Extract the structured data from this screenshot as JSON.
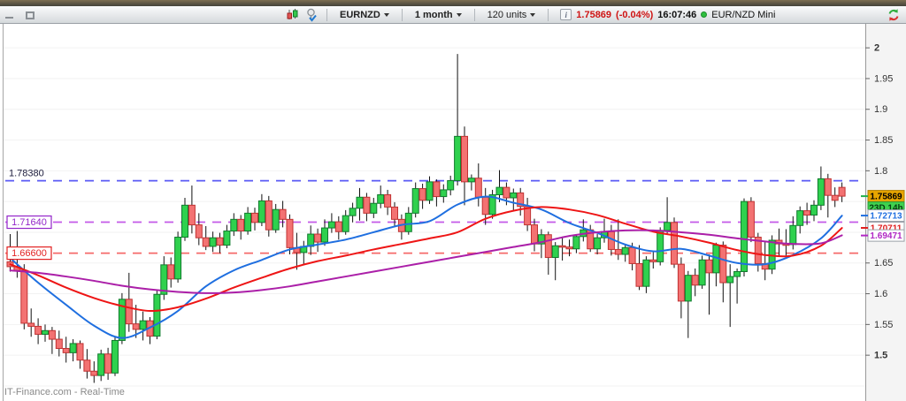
{
  "window": {
    "controls": {
      "minimize": "minimize",
      "maximize": "maximize"
    }
  },
  "toolbar": {
    "symbol_button": "EURNZD",
    "timeframe_button": "1 month",
    "units_button": "120 units",
    "info_icon": "i",
    "last_price": "1.75869",
    "change_percent": "(-0.04%)",
    "last_update_time": "16:07:46",
    "feed_name": "EUR/NZD Mini",
    "icon_names": [
      "candlestick-chart-icon",
      "screener-check-icon",
      "refresh-icon"
    ]
  },
  "footer": {
    "watermark": "IT-Finance.com - Real-Time"
  },
  "chart_data": {
    "type": "candlestick",
    "symbol": "EURNZD",
    "timeframe": "1 month",
    "visible_units": 120,
    "last_price": 1.75869,
    "change_percent": -0.04,
    "period_remaining": "23D 14h",
    "grid": true,
    "y_axis": {
      "range": [
        1.4255,
        2.039
      ],
      "ticks": [
        {
          "value": 2,
          "label": "2",
          "bold": true
        },
        {
          "value": 1.95,
          "label": "1.95",
          "bold": false
        },
        {
          "value": 1.9,
          "label": "1.9",
          "bold": false
        },
        {
          "value": 1.85,
          "label": "1.85",
          "bold": false
        },
        {
          "value": 1.8,
          "label": "1.8",
          "bold": false
        },
        {
          "value": 1.65,
          "label": "1.65",
          "bold": false
        },
        {
          "value": 1.6,
          "label": "1.6",
          "bold": false
        },
        {
          "value": 1.55,
          "label": "1.55",
          "bold": false
        },
        {
          "value": 1.5,
          "label": "1.5",
          "bold": true
        }
      ],
      "grid_step": 0.05
    },
    "horizontal_levels": [
      {
        "price": 1.7838,
        "label": "1.78380",
        "line_color": "#5a5af5",
        "label_style": "plain",
        "label_color": "#1c1c3c"
      },
      {
        "price": 1.7164,
        "label": "1.71640",
        "line_color": "#c45ae8",
        "label_style": "boxed",
        "label_color": "#9326c9"
      },
      {
        "price": 1.666,
        "label": "1.66600",
        "line_color": "#f56a6a",
        "label_style": "boxed",
        "label_color": "#e22222"
      }
    ],
    "price_markers": [
      {
        "name": "current-price-label",
        "label": "1.75869",
        "price": 1.75869,
        "bg": "#e7a500",
        "text": "#000000",
        "border": "#b07f00",
        "tick": "#22b14c"
      },
      {
        "name": "period-countdown-label",
        "label": "23D 14h",
        "stack_below": true,
        "bg": "#3fd14f",
        "text": "#063e10",
        "border": "#2a9a3a"
      },
      {
        "name": "ma-fast-value-label",
        "label": "1.72713",
        "price": 1.72713,
        "bg": "#ffffff",
        "text": "#1f6fe0",
        "border": "#9aa0a8",
        "tick": "#1f6fe0"
      },
      {
        "name": "ma-mid-value-label",
        "label": "1.70711",
        "price": 1.70711,
        "bg": "#ffffff",
        "text": "#e02020",
        "border": "#9aa0a8",
        "tick": "#e02020"
      },
      {
        "name": "ma-slow-value-label",
        "label": "1.69471",
        "price": 1.69471,
        "bg": "#ffffff",
        "text": "#b027c4",
        "border": "#9aa0a8",
        "tick": "#b027c4"
      }
    ],
    "moving_averages": [
      {
        "name": "ma-fast",
        "color": "#1f6fe0",
        "last_value": 1.72713,
        "points": [
          [
            0,
            1.658
          ],
          [
            4,
            1.618
          ],
          [
            8,
            1.582
          ],
          [
            12,
            1.548
          ],
          [
            16,
            1.528
          ],
          [
            20,
            1.545
          ],
          [
            24,
            1.572
          ],
          [
            28,
            1.612
          ],
          [
            32,
            1.638
          ],
          [
            36,
            1.655
          ],
          [
            40,
            1.672
          ],
          [
            44,
            1.68
          ],
          [
            48,
            1.688
          ],
          [
            52,
            1.7
          ],
          [
            56,
            1.712
          ],
          [
            60,
            1.718
          ],
          [
            64,
            1.745
          ],
          [
            68,
            1.758
          ],
          [
            72,
            1.748
          ],
          [
            76,
            1.737
          ],
          [
            80,
            1.715
          ],
          [
            84,
            1.699
          ],
          [
            88,
            1.68
          ],
          [
            92,
            1.669
          ],
          [
            96,
            1.673
          ],
          [
            100,
            1.662
          ],
          [
            104,
            1.65
          ],
          [
            108,
            1.648
          ],
          [
            112,
            1.663
          ],
          [
            116,
            1.69
          ],
          [
            119,
            1.727
          ]
        ]
      },
      {
        "name": "ma-mid",
        "color": "#ee1515",
        "last_value": 1.70711,
        "points": [
          [
            0,
            1.648
          ],
          [
            4,
            1.63
          ],
          [
            8,
            1.61
          ],
          [
            12,
            1.593
          ],
          [
            16,
            1.58
          ],
          [
            20,
            1.572
          ],
          [
            24,
            1.578
          ],
          [
            28,
            1.592
          ],
          [
            32,
            1.61
          ],
          [
            36,
            1.626
          ],
          [
            40,
            1.641
          ],
          [
            44,
            1.653
          ],
          [
            48,
            1.662
          ],
          [
            52,
            1.672
          ],
          [
            56,
            1.681
          ],
          [
            60,
            1.69
          ],
          [
            64,
            1.7
          ],
          [
            68,
            1.722
          ],
          [
            72,
            1.735
          ],
          [
            76,
            1.741
          ],
          [
            80,
            1.737
          ],
          [
            84,
            1.728
          ],
          [
            88,
            1.714
          ],
          [
            92,
            1.701
          ],
          [
            96,
            1.693
          ],
          [
            100,
            1.683
          ],
          [
            104,
            1.671
          ],
          [
            108,
            1.663
          ],
          [
            112,
            1.662
          ],
          [
            116,
            1.678
          ],
          [
            119,
            1.707
          ]
        ]
      },
      {
        "name": "ma-slow",
        "color": "#ab1fa8",
        "last_value": 1.69471,
        "points": [
          [
            0,
            1.638
          ],
          [
            4,
            1.634
          ],
          [
            8,
            1.628
          ],
          [
            12,
            1.621
          ],
          [
            16,
            1.613
          ],
          [
            20,
            1.607
          ],
          [
            24,
            1.603
          ],
          [
            28,
            1.601
          ],
          [
            32,
            1.602
          ],
          [
            36,
            1.606
          ],
          [
            40,
            1.612
          ],
          [
            44,
            1.62
          ],
          [
            48,
            1.628
          ],
          [
            52,
            1.636
          ],
          [
            56,
            1.644
          ],
          [
            60,
            1.652
          ],
          [
            64,
            1.66
          ],
          [
            68,
            1.668
          ],
          [
            72,
            1.676
          ],
          [
            76,
            1.684
          ],
          [
            80,
            1.694
          ],
          [
            84,
            1.7
          ],
          [
            88,
            1.703
          ],
          [
            92,
            1.703
          ],
          [
            96,
            1.7
          ],
          [
            100,
            1.696
          ],
          [
            104,
            1.69
          ],
          [
            108,
            1.685
          ],
          [
            112,
            1.681
          ],
          [
            116,
            1.682
          ],
          [
            119,
            1.695
          ]
        ]
      }
    ],
    "colors": {
      "up_fill": "#2fd14e",
      "up_border": "#117a2e",
      "down_fill": "#f37272",
      "down_border": "#c03232",
      "wick": "#111111",
      "grid": "#f2f2f2",
      "axis_bg": "#f4f4f4",
      "axis_border": "#999999",
      "tick_text": "#333333"
    },
    "candles": [
      [
        1.652,
        1.697,
        1.636,
        1.644
      ],
      [
        1.644,
        1.702,
        1.626,
        1.638
      ],
      [
        1.638,
        1.648,
        1.542,
        1.552
      ],
      [
        1.552,
        1.576,
        1.53,
        1.547
      ],
      [
        1.547,
        1.56,
        1.518,
        1.534
      ],
      [
        1.534,
        1.55,
        1.522,
        1.54
      ],
      [
        1.54,
        1.546,
        1.502,
        1.526
      ],
      [
        1.526,
        1.54,
        1.498,
        1.511
      ],
      [
        1.511,
        1.53,
        1.488,
        1.504
      ],
      [
        1.504,
        1.526,
        1.49,
        1.519
      ],
      [
        1.519,
        1.524,
        1.478,
        1.492
      ],
      [
        1.492,
        1.51,
        1.462,
        1.474
      ],
      [
        1.474,
        1.49,
        1.455,
        1.467
      ],
      [
        1.467,
        1.509,
        1.458,
        1.502
      ],
      [
        1.502,
        1.512,
        1.46,
        1.471
      ],
      [
        1.471,
        1.531,
        1.466,
        1.524
      ],
      [
        1.524,
        1.601,
        1.518,
        1.591
      ],
      [
        1.591,
        1.634,
        1.538,
        1.551
      ],
      [
        1.551,
        1.582,
        1.528,
        1.542
      ],
      [
        1.542,
        1.571,
        1.524,
        1.556
      ],
      [
        1.556,
        1.562,
        1.518,
        1.531
      ],
      [
        1.531,
        1.606,
        1.526,
        1.599
      ],
      [
        1.599,
        1.661,
        1.59,
        1.647
      ],
      [
        1.647,
        1.659,
        1.61,
        1.624
      ],
      [
        1.624,
        1.701,
        1.618,
        1.692
      ],
      [
        1.692,
        1.756,
        1.686,
        1.744
      ],
      [
        1.744,
        1.776,
        1.698,
        1.712
      ],
      [
        1.712,
        1.731,
        1.679,
        1.691
      ],
      [
        1.691,
        1.71,
        1.671,
        1.677
      ],
      [
        1.677,
        1.701,
        1.668,
        1.691
      ],
      [
        1.691,
        1.699,
        1.666,
        1.679
      ],
      [
        1.679,
        1.712,
        1.674,
        1.702
      ],
      [
        1.702,
        1.731,
        1.694,
        1.721
      ],
      [
        1.721,
        1.728,
        1.688,
        1.702
      ],
      [
        1.702,
        1.741,
        1.696,
        1.731
      ],
      [
        1.731,
        1.74,
        1.703,
        1.716
      ],
      [
        1.716,
        1.762,
        1.71,
        1.751
      ],
      [
        1.751,
        1.759,
        1.693,
        1.704
      ],
      [
        1.704,
        1.746,
        1.699,
        1.737
      ],
      [
        1.737,
        1.751,
        1.708,
        1.721
      ],
      [
        1.721,
        1.729,
        1.664,
        1.675
      ],
      [
        1.675,
        1.699,
        1.639,
        1.667
      ],
      [
        1.667,
        1.686,
        1.648,
        1.677
      ],
      [
        1.677,
        1.711,
        1.663,
        1.697
      ],
      [
        1.697,
        1.706,
        1.668,
        1.684
      ],
      [
        1.684,
        1.721,
        1.678,
        1.707
      ],
      [
        1.707,
        1.731,
        1.699,
        1.717
      ],
      [
        1.717,
        1.726,
        1.688,
        1.701
      ],
      [
        1.701,
        1.736,
        1.696,
        1.727
      ],
      [
        1.727,
        1.748,
        1.716,
        1.739
      ],
      [
        1.739,
        1.772,
        1.719,
        1.757
      ],
      [
        1.757,
        1.764,
        1.718,
        1.731
      ],
      [
        1.731,
        1.756,
        1.723,
        1.747
      ],
      [
        1.747,
        1.776,
        1.739,
        1.761
      ],
      [
        1.761,
        1.769,
        1.728,
        1.741
      ],
      [
        1.741,
        1.749,
        1.708,
        1.721
      ],
      [
        1.721,
        1.729,
        1.688,
        1.701
      ],
      [
        1.701,
        1.741,
        1.696,
        1.731
      ],
      [
        1.731,
        1.781,
        1.724,
        1.771
      ],
      [
        1.771,
        1.779,
        1.738,
        1.752
      ],
      [
        1.752,
        1.791,
        1.746,
        1.782
      ],
      [
        1.782,
        1.786,
        1.742,
        1.758
      ],
      [
        1.758,
        1.778,
        1.748,
        1.769
      ],
      [
        1.769,
        1.792,
        1.76,
        1.784
      ],
      [
        1.784,
        1.99,
        1.776,
        1.856
      ],
      [
        1.856,
        1.872,
        1.744,
        1.782
      ],
      [
        1.782,
        1.794,
        1.768,
        1.788
      ],
      [
        1.788,
        1.812,
        1.742,
        1.757
      ],
      [
        1.757,
        1.772,
        1.712,
        1.729
      ],
      [
        1.729,
        1.769,
        1.722,
        1.761
      ],
      [
        1.761,
        1.801,
        1.749,
        1.773
      ],
      [
        1.773,
        1.781,
        1.744,
        1.756
      ],
      [
        1.756,
        1.771,
        1.736,
        1.764
      ],
      [
        1.764,
        1.772,
        1.727,
        1.742
      ],
      [
        1.742,
        1.756,
        1.702,
        1.712
      ],
      [
        1.712,
        1.722,
        1.669,
        1.681
      ],
      [
        1.681,
        1.705,
        1.658,
        1.696
      ],
      [
        1.696,
        1.701,
        1.631,
        1.659
      ],
      [
        1.659,
        1.684,
        1.622,
        1.678
      ],
      [
        1.678,
        1.693,
        1.654,
        1.676
      ],
      [
        1.676,
        1.688,
        1.661,
        1.673
      ],
      [
        1.673,
        1.697,
        1.666,
        1.693
      ],
      [
        1.693,
        1.721,
        1.685,
        1.704
      ],
      [
        1.704,
        1.712,
        1.668,
        1.673
      ],
      [
        1.673,
        1.697,
        1.664,
        1.691
      ],
      [
        1.691,
        1.722,
        1.683,
        1.701
      ],
      [
        1.701,
        1.712,
        1.662,
        1.672
      ],
      [
        1.672,
        1.721,
        1.655,
        1.664
      ],
      [
        1.664,
        1.681,
        1.652,
        1.675
      ],
      [
        1.675,
        1.683,
        1.638,
        1.649
      ],
      [
        1.649,
        1.679,
        1.606,
        1.612
      ],
      [
        1.612,
        1.661,
        1.601,
        1.655
      ],
      [
        1.655,
        1.668,
        1.641,
        1.652
      ],
      [
        1.652,
        1.708,
        1.646,
        1.703
      ],
      [
        1.703,
        1.757,
        1.696,
        1.716
      ],
      [
        1.716,
        1.724,
        1.642,
        1.648
      ],
      [
        1.648,
        1.659,
        1.56,
        1.588
      ],
      [
        1.588,
        1.637,
        1.528,
        1.63
      ],
      [
        1.63,
        1.641,
        1.596,
        1.614
      ],
      [
        1.614,
        1.662,
        1.608,
        1.655
      ],
      [
        1.655,
        1.664,
        1.566,
        1.634
      ],
      [
        1.634,
        1.683,
        1.612,
        1.679
      ],
      [
        1.679,
        1.685,
        1.586,
        1.618
      ],
      [
        1.618,
        1.648,
        1.546,
        1.628
      ],
      [
        1.628,
        1.641,
        1.584,
        1.636
      ],
      [
        1.636,
        1.755,
        1.628,
        1.75
      ],
      [
        1.75,
        1.757,
        1.684,
        1.692
      ],
      [
        1.692,
        1.699,
        1.636,
        1.649
      ],
      [
        1.649,
        1.684,
        1.622,
        1.64
      ],
      [
        1.64,
        1.695,
        1.632,
        1.687
      ],
      [
        1.687,
        1.706,
        1.661,
        1.681
      ],
      [
        1.681,
        1.705,
        1.662,
        1.68
      ],
      [
        1.68,
        1.726,
        1.672,
        1.711
      ],
      [
        1.711,
        1.742,
        1.698,
        1.735
      ],
      [
        1.735,
        1.748,
        1.712,
        1.728
      ],
      [
        1.728,
        1.752,
        1.718,
        1.744
      ],
      [
        1.744,
        1.807,
        1.736,
        1.787
      ],
      [
        1.787,
        1.795,
        1.724,
        1.76
      ],
      [
        1.76,
        1.773,
        1.741,
        1.752
      ],
      [
        1.773,
        1.781,
        1.749,
        1.75869
      ]
    ]
  }
}
